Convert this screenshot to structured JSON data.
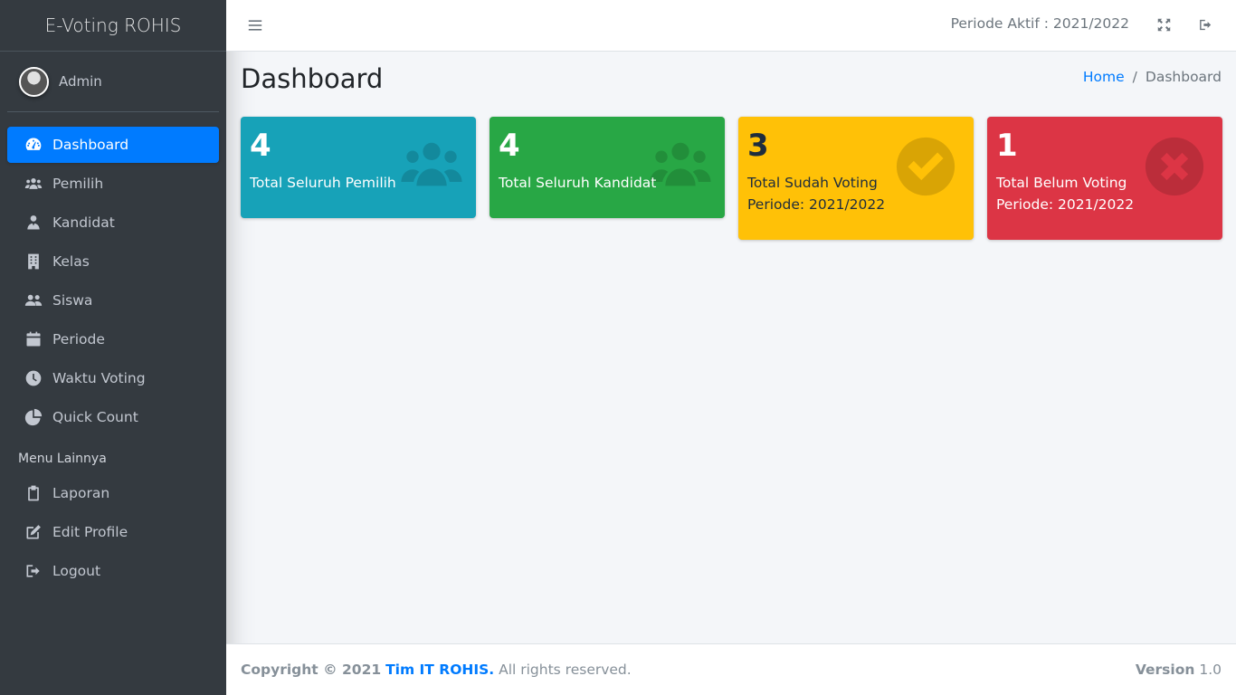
{
  "app": {
    "brand": "E-Voting ROHIS"
  },
  "user": {
    "name": "Admin"
  },
  "sidebar": {
    "items": [
      {
        "label": "Dashboard",
        "icon": "tachometer-icon",
        "active": true
      },
      {
        "label": "Pemilih",
        "icon": "users-icon"
      },
      {
        "label": "Kandidat",
        "icon": "user-tie-icon"
      },
      {
        "label": "Kelas",
        "icon": "building-icon"
      },
      {
        "label": "Siswa",
        "icon": "user-friends-icon"
      },
      {
        "label": "Periode",
        "icon": "calendar-icon"
      },
      {
        "label": "Waktu Voting",
        "icon": "clock-icon"
      },
      {
        "label": "Quick Count",
        "icon": "chart-pie-icon"
      }
    ],
    "header": "Menu Lainnya",
    "items2": [
      {
        "label": "Laporan",
        "icon": "clipboard-icon"
      },
      {
        "label": "Edit Profile",
        "icon": "edit-icon"
      },
      {
        "label": "Logout",
        "icon": "sign-out-icon"
      }
    ]
  },
  "topbar": {
    "periode": "Periode Aktif : 2021/2022"
  },
  "page": {
    "title": "Dashboard"
  },
  "breadcrumb": {
    "home": "Home",
    "sep": "/",
    "current": "Dashboard"
  },
  "boxes": [
    {
      "value": "4",
      "label": "Total Seluruh Pemilih",
      "color": "#17a2b8",
      "icon": "users-icon"
    },
    {
      "value": "4",
      "label": "Total Seluruh Kandidat",
      "color": "#28a745",
      "icon": "users-icon"
    },
    {
      "value": "3",
      "label": "Total Sudah Voting",
      "sub": "Periode: 2021/2022",
      "color": "#ffc107",
      "icon": "check-circle-icon"
    },
    {
      "value": "1",
      "label": "Total Belum Voting",
      "sub": "Periode: 2021/2022",
      "color": "#dc3545",
      "icon": "times-circle-icon"
    }
  ],
  "footer": {
    "copyright": "Copyright © 2021",
    "team": "Tim IT ROHIS.",
    "rights": "All rights reserved.",
    "version_label": "Version",
    "version": "1.0"
  }
}
